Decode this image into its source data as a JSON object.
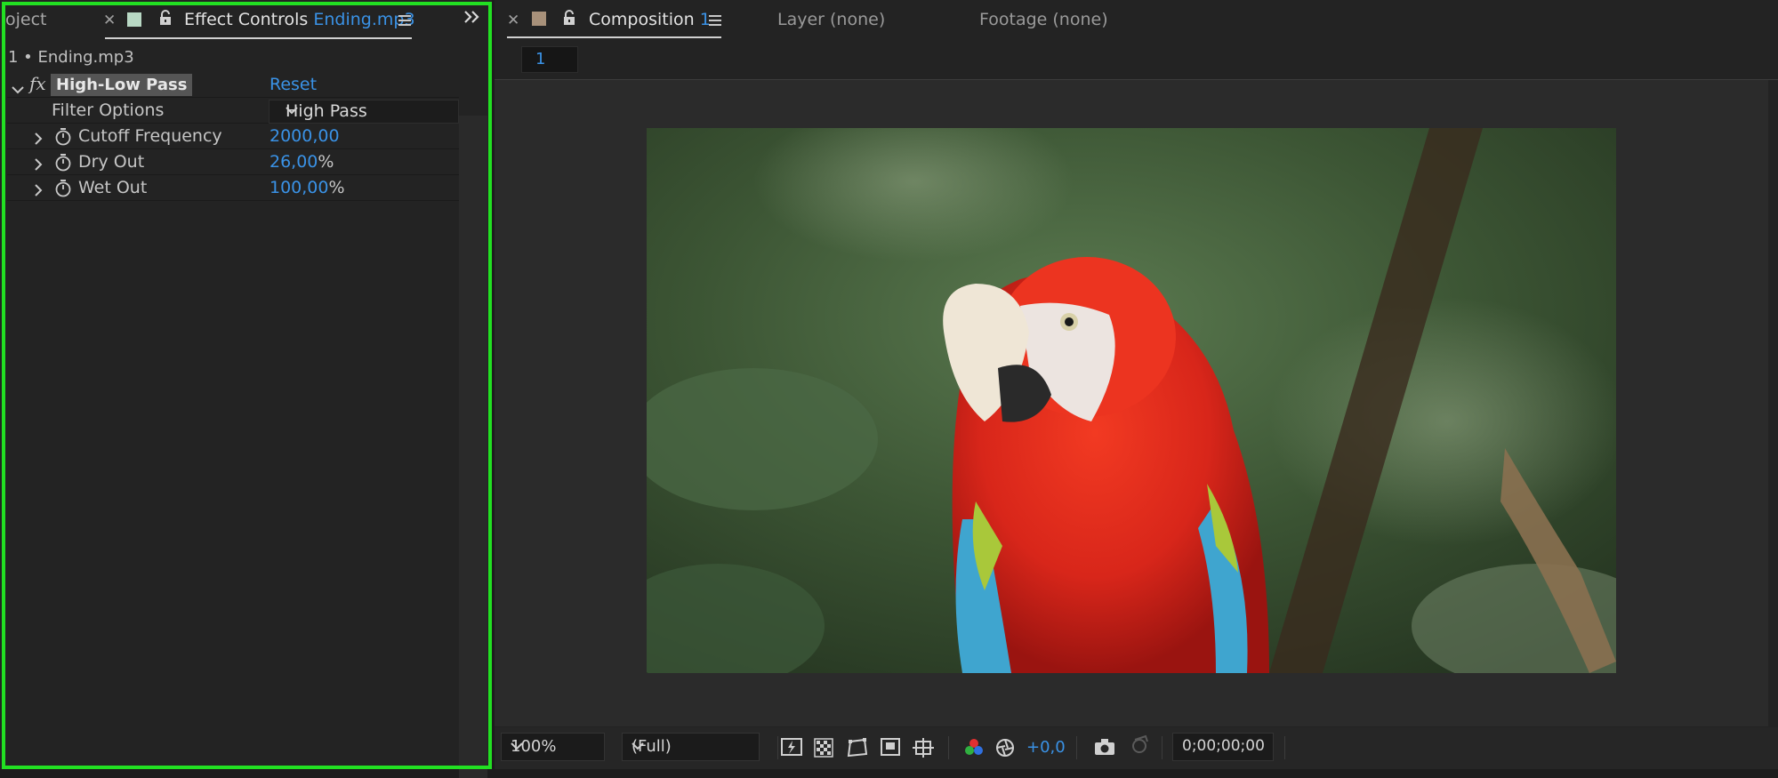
{
  "left_panel": {
    "tabs": {
      "project_partial": "oject",
      "effect_controls_label": "Effect Controls",
      "effect_controls_file": "Ending.mp3",
      "swatch_color": "#b8d8c4"
    },
    "layer_path": "1 • Ending.mp3",
    "effect": {
      "name": "High-Low Pass",
      "reset_label": "Reset",
      "params": [
        {
          "label": "Filter Options",
          "value": "High Pass",
          "type": "dropdown"
        },
        {
          "label": "Cutoff Frequency",
          "value": "2000,00",
          "unit": ""
        },
        {
          "label": "Dry Out",
          "value": "26,00",
          "unit": "%"
        },
        {
          "label": "Wet Out",
          "value": "100,00",
          "unit": "%"
        }
      ]
    }
  },
  "right_panel": {
    "tabs": {
      "composition_label": "Composition",
      "composition_number": "1",
      "swatch_color": "#a8917a",
      "layer_label": "Layer (none)",
      "footage_label": "Footage (none)"
    },
    "comp_badge": "1",
    "bottom_bar": {
      "zoom": "100%",
      "resolution": "(Full)",
      "exposure": "+0,0",
      "timecode": "0;00;00;00"
    }
  }
}
